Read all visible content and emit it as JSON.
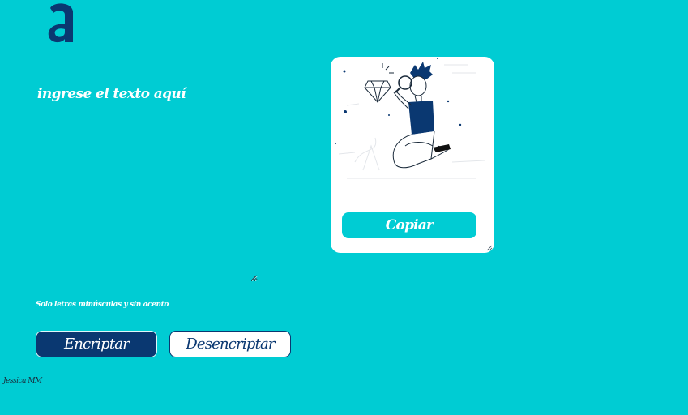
{
  "logo": {
    "icon": "alura-a-logo-icon",
    "color": "#0a3871"
  },
  "input": {
    "placeholder": "ingrese el texto aquí",
    "value": ""
  },
  "hint": {
    "text": "Solo letras minúsculas y sin acento"
  },
  "buttons": {
    "encrypt_label": "Encriptar",
    "decrypt_label": "Desencriptar",
    "copy_label": "Copiar"
  },
  "output": {
    "illustration": "person-with-magnifying-glass-and-diamond-illustration",
    "value": ""
  },
  "footer": {
    "text": "Jessica MM"
  },
  "colors": {
    "background": "#00ccd3",
    "primary": "#0a3871",
    "white": "#ffffff"
  }
}
